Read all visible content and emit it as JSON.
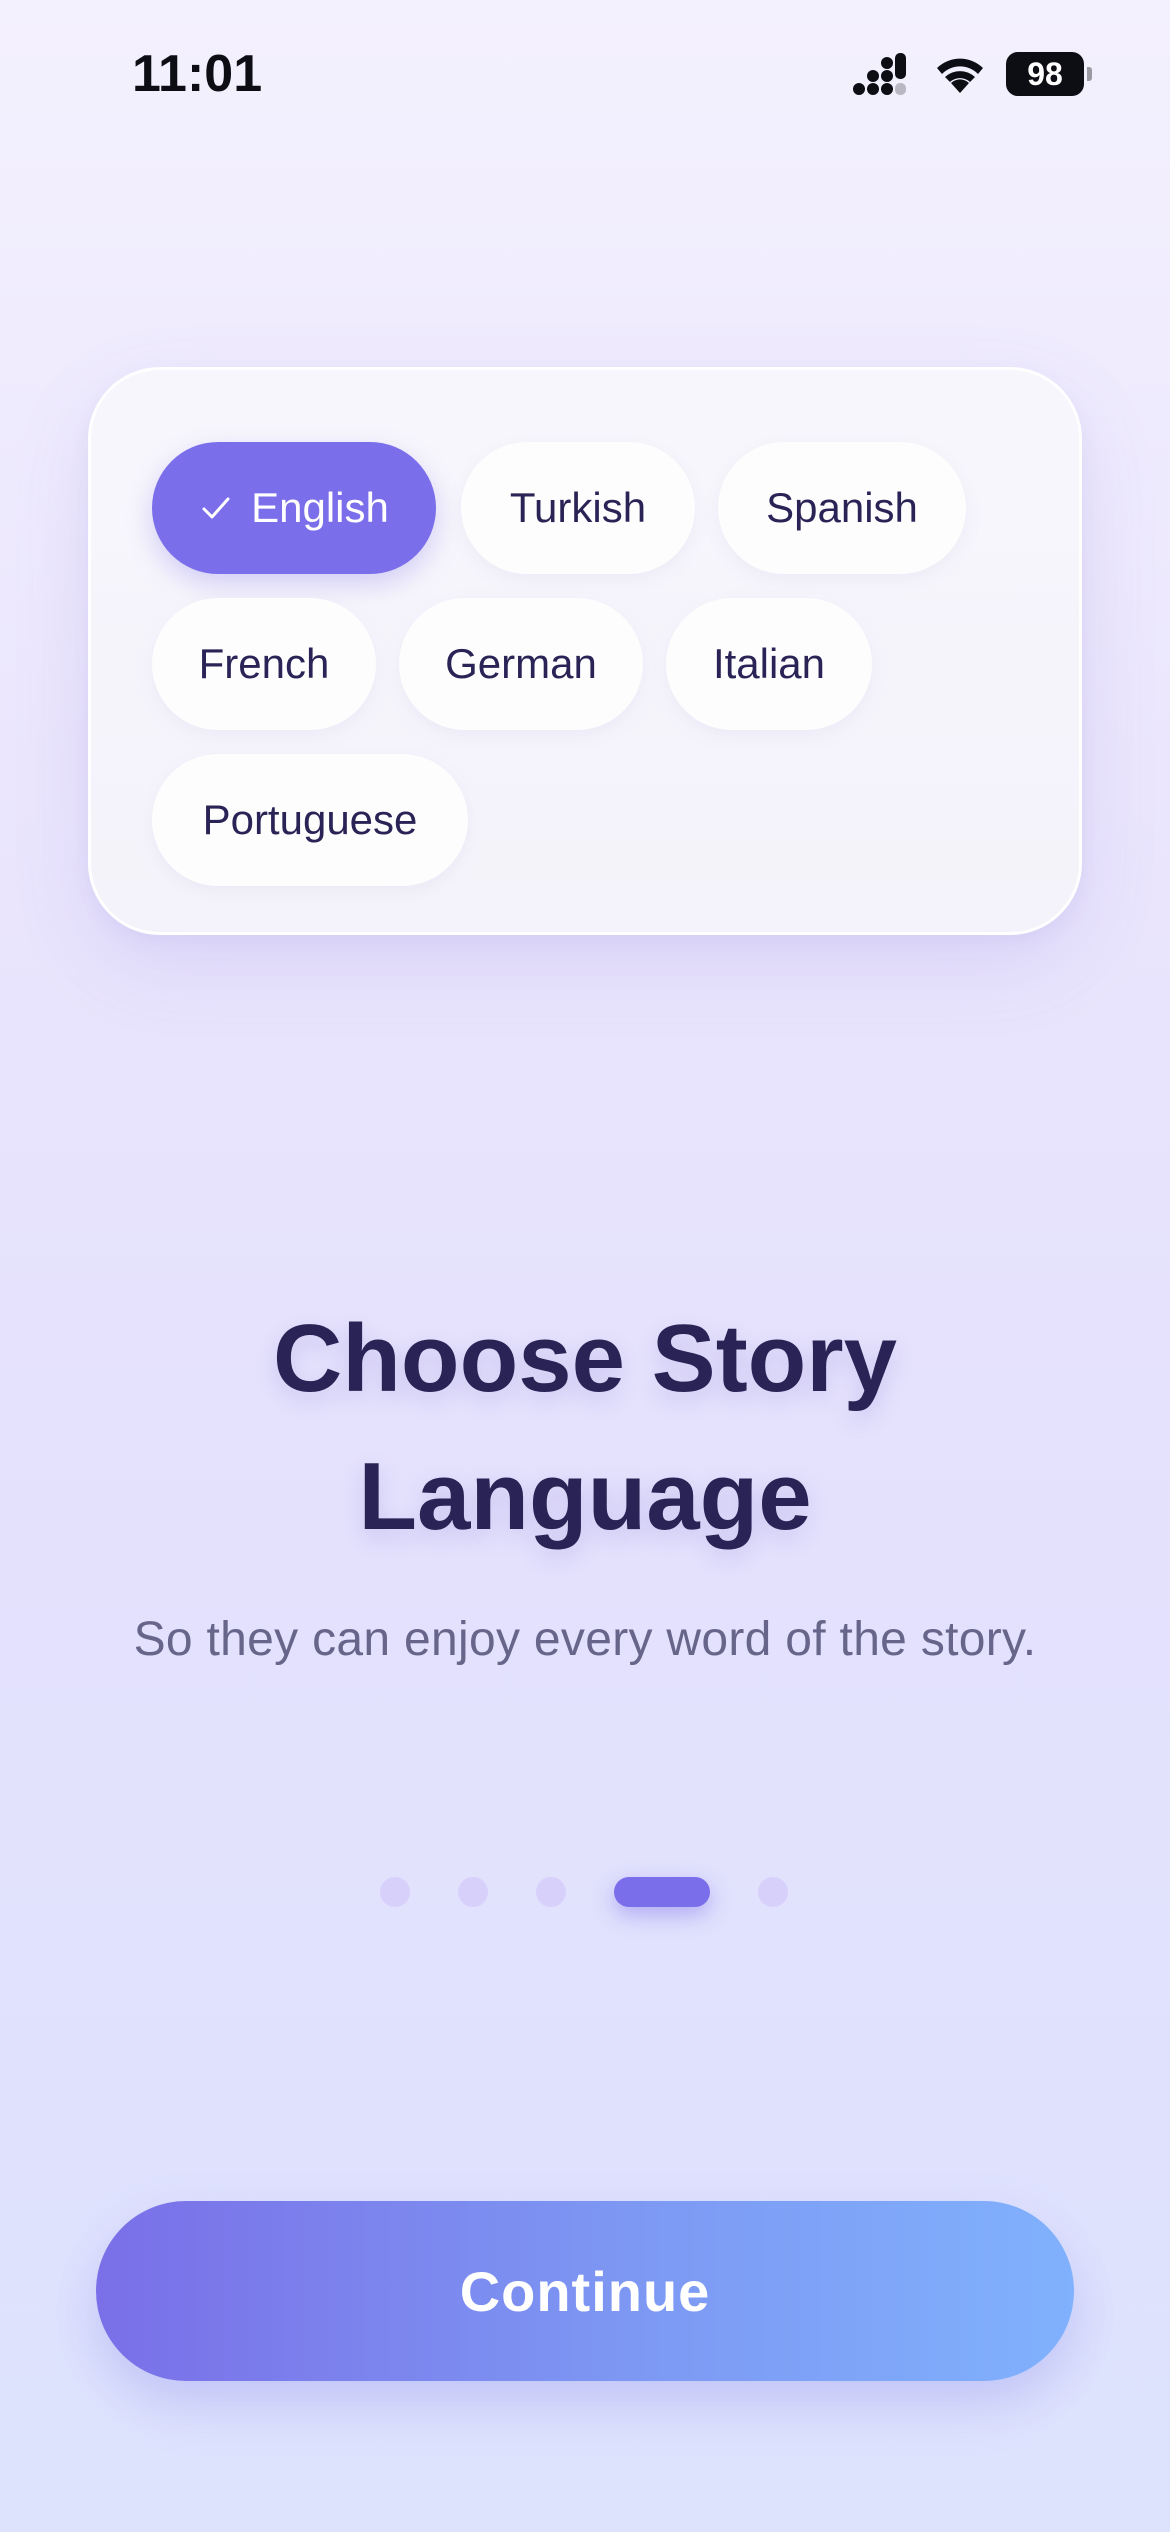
{
  "status_bar": {
    "time": "11:01",
    "battery_level": "98",
    "icons": [
      "signal-icon",
      "wifi-icon",
      "battery-icon"
    ]
  },
  "language_picker": {
    "languages": [
      {
        "label": "English",
        "selected": true,
        "icon": "check-icon"
      },
      {
        "label": "Turkish",
        "selected": false
      },
      {
        "label": "Spanish",
        "selected": false
      },
      {
        "label": "French",
        "selected": false
      },
      {
        "label": "German",
        "selected": false
      },
      {
        "label": "Italian",
        "selected": false
      },
      {
        "label": "Portuguese",
        "selected": false
      }
    ]
  },
  "content": {
    "title_line1": "Choose Story",
    "title_line2": "Language",
    "subtitle": "So they can enjoy every word of the story."
  },
  "pager": {
    "total_pages": 5,
    "current_page": 4
  },
  "actions": {
    "continue_label": "Continue"
  },
  "colors": {
    "accent": "#7b6eea",
    "text_primary": "#2a2456",
    "text_secondary": "#68658a",
    "dot_inactive": "#d6d0fb",
    "button_gradient_start": "#7a6fe8",
    "button_gradient_end": "#80b1fd"
  }
}
